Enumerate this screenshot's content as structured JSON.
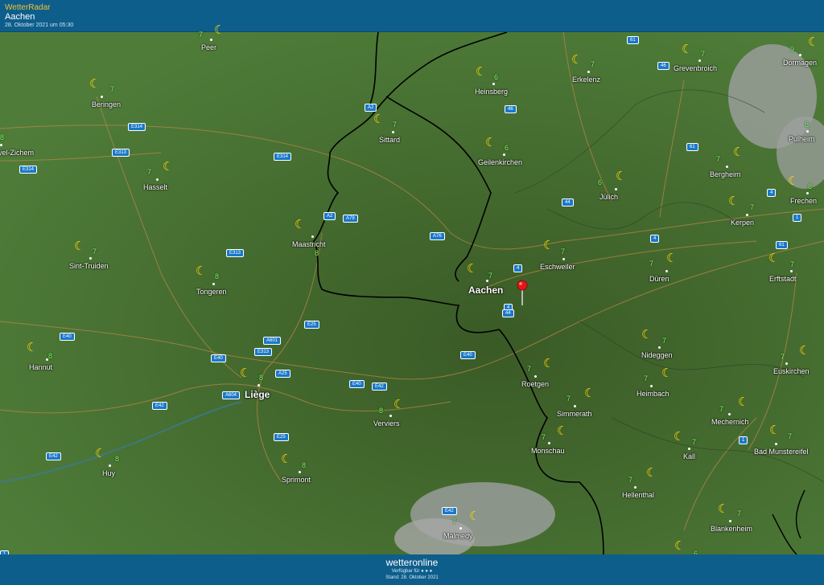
{
  "header": {
    "brand": "WetterRadar",
    "location": "Aachen",
    "timestamp": "28. Oktober 2021 um 05:30"
  },
  "footer": {
    "logo": "wetteronline",
    "available": "Verfügbar für",
    "stand": "Stand: 28. Oktober 2021"
  },
  "colors": {
    "header_bg": "#0e5e8c",
    "temperature_text": "#7dff5e",
    "moon": "#ffd400",
    "road_shield": "#1a78c8"
  },
  "icons": {
    "night_clear": "crescent-moon-icon",
    "location_marker": "red-pin-icon"
  },
  "cities": [
    {
      "name": "Peer",
      "temp": "7"
    },
    {
      "name": "Beringen",
      "temp": "7"
    },
    {
      "name": "vel-Zichem",
      "temp": "8"
    },
    {
      "name": "Hasselt",
      "temp": "7"
    },
    {
      "name": "Sint-Truiden",
      "temp": "7"
    },
    {
      "name": "Tongeren",
      "temp": "8"
    },
    {
      "name": "Hannut",
      "temp": "8"
    },
    {
      "name": "Huy",
      "temp": "8"
    },
    {
      "name": "Liège",
      "temp": "8"
    },
    {
      "name": "Sprimont",
      "temp": "8"
    },
    {
      "name": "Verviers",
      "temp": "8"
    },
    {
      "name": "Maastricht",
      "temp": "8"
    },
    {
      "name": "Sittard",
      "temp": "7"
    },
    {
      "name": "Heinsberg",
      "temp": "6"
    },
    {
      "name": "Geilenkirchen",
      "temp": "6"
    },
    {
      "name": "Erkelenz",
      "temp": "7"
    },
    {
      "name": "Grevenbroich",
      "temp": "7"
    },
    {
      "name": "Dormagen",
      "temp": "9"
    },
    {
      "name": "Pulheim",
      "temp": "8"
    },
    {
      "name": "Bergheim",
      "temp": "7"
    },
    {
      "name": "Frechen",
      "temp": "8"
    },
    {
      "name": "Jülich",
      "temp": "6"
    },
    {
      "name": "Kerpen",
      "temp": "7"
    },
    {
      "name": "Eschweiler",
      "temp": "7"
    },
    {
      "name": "Aachen",
      "temp": "7"
    },
    {
      "name": "Düren",
      "temp": "7"
    },
    {
      "name": "Erftstadt",
      "temp": "7"
    },
    {
      "name": "Nideggen",
      "temp": "7"
    },
    {
      "name": "Euskirchen",
      "temp": "7"
    },
    {
      "name": "Roetgen",
      "temp": "7"
    },
    {
      "name": "Heimbach",
      "temp": "7"
    },
    {
      "name": "Simmerath",
      "temp": "7"
    },
    {
      "name": "Mechernich",
      "temp": "7"
    },
    {
      "name": "Monschau",
      "temp": "7"
    },
    {
      "name": "Kall",
      "temp": "7"
    },
    {
      "name": "Bad Munstereifel",
      "temp": "7"
    },
    {
      "name": "Hellenthal",
      "temp": "7"
    },
    {
      "name": "Blankenheim",
      "temp": "7"
    },
    {
      "name": "Malmedy",
      "temp": "7"
    },
    {
      "name": "",
      "temp": "6"
    }
  ],
  "roads": [
    "61",
    "46",
    "46",
    "A2",
    "E314",
    "E313",
    "E314",
    "E314",
    "A2",
    "A79",
    "A76",
    "61",
    "44",
    "4",
    "4",
    "4",
    "1",
    "61",
    "E313",
    "4",
    "44",
    "E40",
    "E40",
    "A601",
    "E313",
    "E40",
    "E25",
    "A25",
    "A604",
    "E42",
    "E40",
    "E42",
    "E42",
    "E25",
    "1",
    "E42",
    "1"
  ]
}
